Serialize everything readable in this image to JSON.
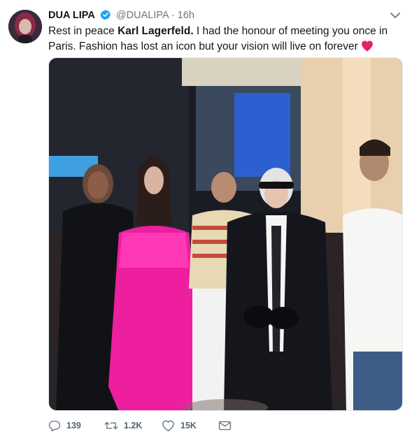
{
  "tweet": {
    "display_name": "DUA LIPA",
    "handle": "@DUALIPA",
    "separator": "·",
    "time": "16h",
    "text_part1": "Rest in peace ",
    "text_bold": "Karl Lagerfeld.",
    "text_part2": " I had the honour of meeting you once in Paris. Fashion has lost an icon but your vision will live on forever",
    "emoji": "red-heart-emoji"
  },
  "actions": {
    "reply_count": "139",
    "retweet_count": "1.2K",
    "like_count": "15K"
  },
  "colors": {
    "text": "#14171a",
    "muted": "#657786",
    "verified": "#1da1f2",
    "heart": "#e0245e"
  }
}
